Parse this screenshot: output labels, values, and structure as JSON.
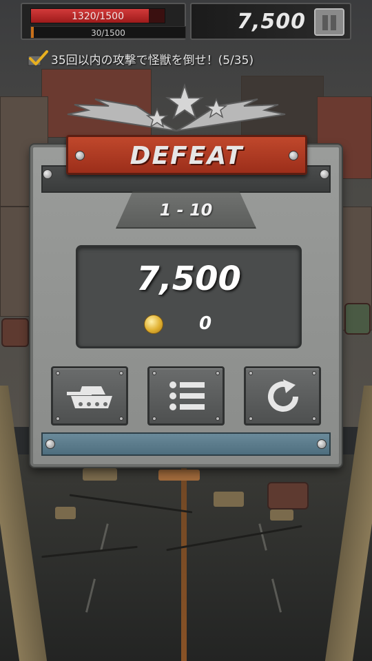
{
  "hud": {
    "hp_text": "1320/1500",
    "hp_fraction": 0.88,
    "sub_text": "30/1500",
    "sub_fraction": 0.02,
    "score": "7,500",
    "pause_icon": "pause-icon"
  },
  "mission": {
    "text": "35回以内の攻撃で怪獣を倒せ！(5/35)",
    "icon": "checkmark-icon"
  },
  "result": {
    "banner": "DEFEAT",
    "stage": "1 - 10",
    "score": "7,500",
    "coins": "0",
    "coin_icon": "coin-icon"
  },
  "actions": [
    {
      "icon": "tank-icon"
    },
    {
      "icon": "list-icon"
    },
    {
      "icon": "retry-icon"
    }
  ],
  "colors": {
    "banner": "#b03a22",
    "hp": "#d23a3a",
    "sub": "#c8701a",
    "panel": "#8a8c8a"
  }
}
